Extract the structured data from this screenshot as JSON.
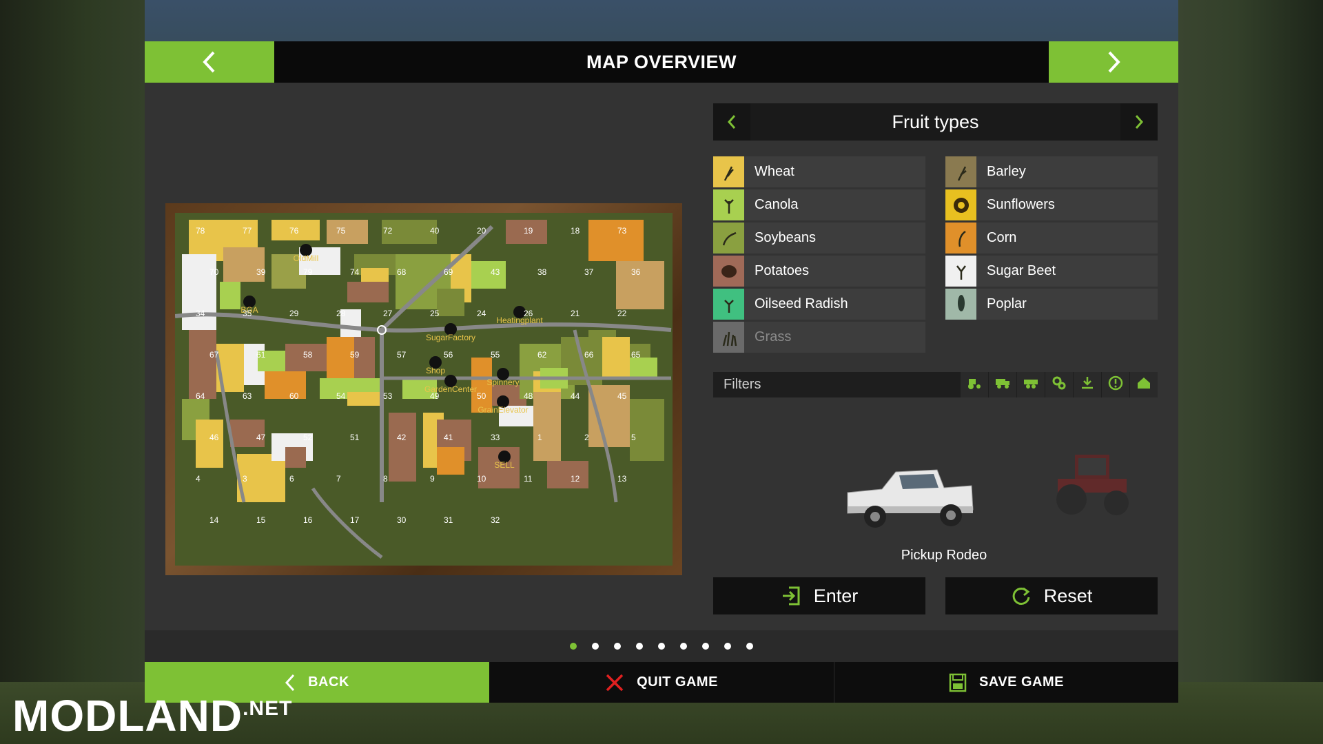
{
  "header": {
    "title": "MAP OVERVIEW"
  },
  "fruit_panel": {
    "title": "Fruit types",
    "items": [
      {
        "label": "Wheat",
        "icon": "wheat-icon",
        "color": "#e8c44a",
        "enabled": true
      },
      {
        "label": "Barley",
        "icon": "barley-icon",
        "color": "#8a7a50",
        "enabled": true
      },
      {
        "label": "Canola",
        "icon": "canola-icon",
        "color": "#a8d050",
        "enabled": true
      },
      {
        "label": "Sunflowers",
        "icon": "sunflower-icon",
        "color": "#e8c020",
        "enabled": true
      },
      {
        "label": "Soybeans",
        "icon": "soybean-icon",
        "color": "#8aa040",
        "enabled": true
      },
      {
        "label": "Corn",
        "icon": "corn-icon",
        "color": "#e0902a",
        "enabled": true
      },
      {
        "label": "Potatoes",
        "icon": "potato-icon",
        "color": "#a06a58",
        "enabled": true
      },
      {
        "label": "Sugar Beet",
        "icon": "sugarbeet-icon",
        "color": "#f0f0f0",
        "enabled": true
      },
      {
        "label": "Oilseed Radish",
        "icon": "radish-icon",
        "color": "#40c080",
        "enabled": true
      },
      {
        "label": "Poplar",
        "icon": "poplar-icon",
        "color": "#a0b8a8",
        "enabled": true
      },
      {
        "label": "Grass",
        "icon": "grass-icon",
        "color": "#6a6a6a",
        "enabled": false
      }
    ]
  },
  "filters": {
    "label": "Filters",
    "icons": [
      "tractor-icon",
      "truck-icon",
      "trailer-icon",
      "gears-icon",
      "unload-icon",
      "warning-icon",
      "home-icon"
    ]
  },
  "vehicle": {
    "name": "Pickup Rodeo",
    "enter_label": "Enter",
    "reset_label": "Reset"
  },
  "pager": {
    "count": 9,
    "active": 0
  },
  "footer": {
    "back_label": "BACK",
    "quit_label": "QUIT GAME",
    "save_label": "SAVE GAME"
  },
  "watermark": {
    "main": "MODLAND",
    "suffix": ".NET"
  },
  "map": {
    "labels": [
      "OldMill",
      "BGA",
      "SugarFactory",
      "Heatingplant",
      "Shop",
      "GardenCenter",
      "Spinnery",
      "GrainElevator",
      "SELL"
    ],
    "field_numbers": [
      "78",
      "77",
      "76",
      "75",
      "72",
      "40",
      "20",
      "19",
      "18",
      "73",
      "70",
      "39",
      "79",
      "74",
      "68",
      "69",
      "43",
      "38",
      "37",
      "36",
      "34",
      "35",
      "29",
      "28",
      "27",
      "25",
      "24",
      "26",
      "21",
      "22",
      "67",
      "61",
      "58",
      "59",
      "57",
      "56",
      "55",
      "62",
      "66",
      "65",
      "64",
      "63",
      "60",
      "54",
      "53",
      "49",
      "50",
      "48",
      "44",
      "45",
      "46",
      "47",
      "52",
      "51",
      "42",
      "41",
      "33",
      "1",
      "2",
      "5",
      "4",
      "3",
      "6",
      "7",
      "8",
      "9",
      "10",
      "11",
      "12",
      "13",
      "14",
      "15",
      "16",
      "17",
      "30",
      "31",
      "32"
    ]
  },
  "colors": {
    "accent": "#7ec135",
    "panel": "#333333",
    "header": "#0a0a0a"
  }
}
